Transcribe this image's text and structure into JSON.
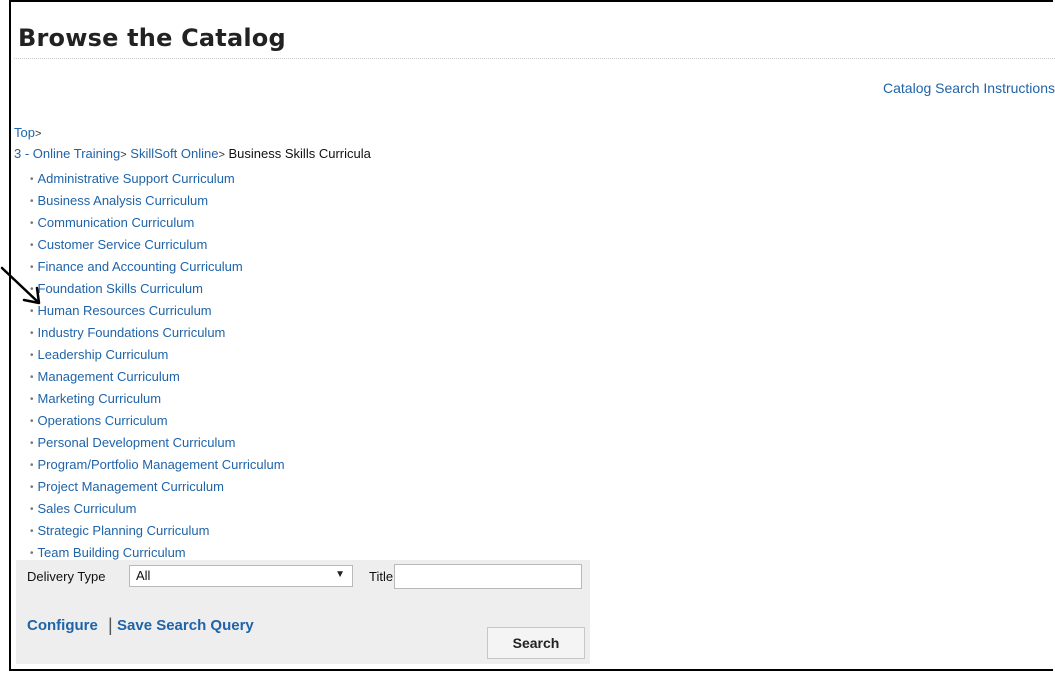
{
  "page": {
    "title": "Browse the Catalog",
    "search_instructions": "Catalog Search Instructions"
  },
  "breadcrumb": {
    "top": "Top",
    "separator": ">",
    "path": [
      {
        "label": "3 - Online Training",
        "link": true
      },
      {
        "label": "SkillSoft Online",
        "link": true
      },
      {
        "label": "Business Skills Curricula",
        "link": false
      }
    ]
  },
  "categories": [
    "Administrative Support Curriculum",
    "Business Analysis Curriculum",
    "Communication Curriculum",
    "Customer Service Curriculum",
    "Finance and Accounting Curriculum",
    "Foundation Skills Curriculum",
    "Human Resources Curriculum",
    "Industry Foundations Curriculum",
    "Leadership Curriculum",
    "Management Curriculum",
    "Marketing Curriculum",
    "Operations Curriculum",
    "Personal Development Curriculum",
    "Program/Portfolio Management Curriculum",
    "Project Management Curriculum",
    "Sales Curriculum",
    "Strategic Planning Curriculum",
    "Team Building Curriculum"
  ],
  "search_panel": {
    "delivery_type_label": "Delivery Type",
    "delivery_type_value": "All",
    "title_label": "Title",
    "title_value": "",
    "configure_label": "Configure",
    "pipe": "|",
    "save_query_label": "Save Search Query",
    "search_button_label": "Search"
  },
  "colors": {
    "link": "#1f63a8",
    "panel_bg": "#eeeeee",
    "annotation_arrow": "#000000"
  },
  "annotation": {
    "arrow_icon": "arrow-pointer-icon",
    "points_to": "Human Resources Curriculum"
  }
}
